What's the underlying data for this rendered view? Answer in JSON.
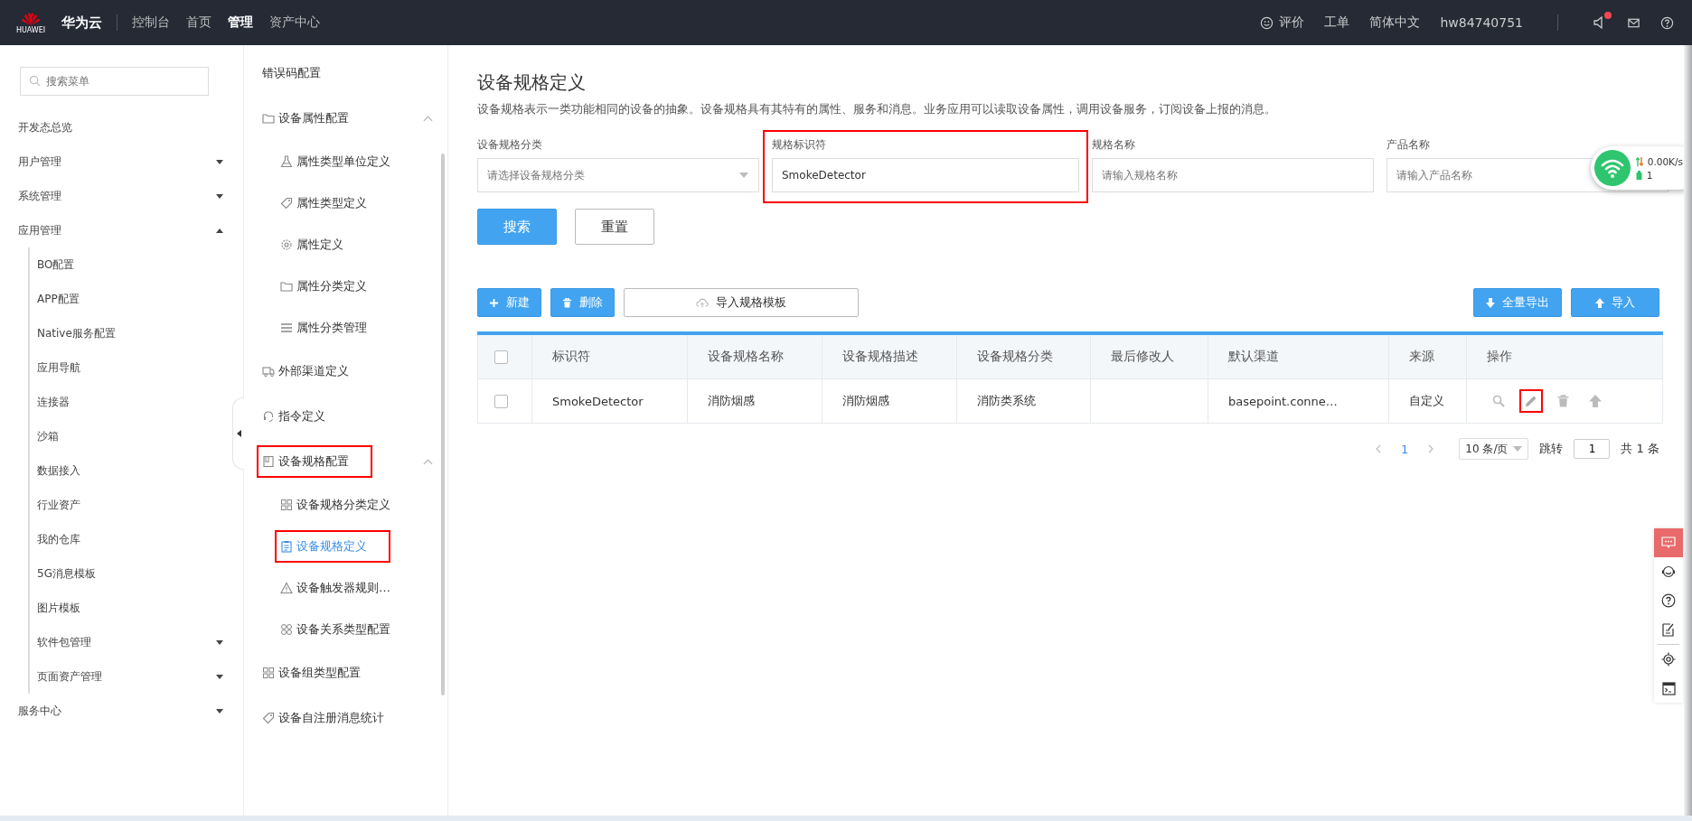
{
  "topbar": {
    "logo_text": "HUAWEI",
    "brand": "华为云",
    "nav": [
      {
        "label": "控制台",
        "selected": false
      },
      {
        "label": "首页",
        "selected": false
      },
      {
        "label": "管理",
        "selected": true
      },
      {
        "label": "资产中心",
        "selected": false
      }
    ],
    "right": {
      "feedback": "评价",
      "ticket": "工单",
      "language": "简体中文",
      "user": "hw84740751",
      "notification_dot": true
    }
  },
  "menu": {
    "search": {
      "placeholder": "搜索菜单"
    },
    "items": [
      {
        "label": "开发态总览"
      },
      {
        "label": "用户管理",
        "expanded": false
      },
      {
        "label": "系统管理",
        "expanded": false
      },
      {
        "label": "应用管理",
        "expanded": true,
        "children": [
          {
            "label": "BO配置"
          },
          {
            "label": "APP配置"
          },
          {
            "label": "Native服务配置"
          },
          {
            "label": "应用导航"
          },
          {
            "label": "连接器"
          },
          {
            "label": "沙箱"
          },
          {
            "label": "数据接入"
          },
          {
            "label": "行业资产"
          },
          {
            "label": "我的仓库"
          },
          {
            "label": "5G消息模板"
          },
          {
            "label": "图片模板"
          },
          {
            "label": "软件包管理",
            "expanded": false
          },
          {
            "label": "页面资产管理",
            "expanded": false
          }
        ]
      },
      {
        "label": "服务中心",
        "expanded": false
      }
    ]
  },
  "submenu": {
    "items": [
      {
        "label": "错误码配置",
        "highlighted": false,
        "selected": false
      },
      {
        "label": "设备属性配置",
        "expanded": true,
        "highlighted": false,
        "selected": false,
        "children": [
          {
            "label": "属性类型单位定义",
            "highlighted": false,
            "selected": false
          },
          {
            "label": "属性类型定义",
            "highlighted": false,
            "selected": false
          },
          {
            "label": "属性定义",
            "highlighted": false,
            "selected": false
          },
          {
            "label": "属性分类定义",
            "highlighted": false,
            "selected": false
          },
          {
            "label": "属性分类管理",
            "highlighted": false,
            "selected": false
          }
        ]
      },
      {
        "label": "外部渠道定义",
        "highlighted": false,
        "selected": false
      },
      {
        "label": "指令定义",
        "highlighted": false,
        "selected": false
      },
      {
        "label": "设备规格配置",
        "expanded": true,
        "highlighted": true,
        "selected": false,
        "children": [
          {
            "label": "设备规格分类定义",
            "highlighted": false,
            "selected": false
          },
          {
            "label": "设备规格定义",
            "highlighted": true,
            "selected": true
          },
          {
            "label": "设备触发器规则…",
            "highlighted": false,
            "selected": false
          },
          {
            "label": "设备关系类型配置",
            "highlighted": false,
            "selected": false
          }
        ]
      },
      {
        "label": "设备组类型配置",
        "highlighted": false,
        "selected": false
      },
      {
        "label": "设备自注册消息统计",
        "highlighted": false,
        "selected": false
      }
    ]
  },
  "page": {
    "title": "设备规格定义",
    "description": "设备规格表示一类功能相同的设备的抽象。设备规格具有其特有的属性、服务和消息。业务应用可以读取设备属性，调用设备服务，订阅设备上报的消息。",
    "filters": [
      {
        "label": "设备规格分类",
        "kind": "select",
        "placeholder": "请选择设备规格分类",
        "highlighted": false
      },
      {
        "label": "规格标识符",
        "kind": "text",
        "value": "SmokeDetector",
        "highlighted": true
      },
      {
        "label": "规格名称",
        "kind": "text",
        "placeholder": "请输入规格名称",
        "highlighted": false
      },
      {
        "label": "产品名称",
        "kind": "text",
        "placeholder": "请输入产品名称",
        "highlighted": false
      }
    ],
    "search_button": "搜索",
    "reset_button": "重置",
    "toolbar_left": [
      {
        "label": "新建",
        "kind": "primary"
      },
      {
        "label": "删除",
        "kind": "primary"
      },
      {
        "label": "导入规格模板",
        "kind": "outline"
      }
    ],
    "toolbar_right": [
      {
        "label": "全量导出",
        "kind": "primary"
      },
      {
        "label": "导入",
        "kind": "primary"
      }
    ],
    "table": {
      "all_checked": false,
      "columns": [
        "标识符",
        "设备规格名称",
        "设备规格描述",
        "设备规格分类",
        "最后修改人",
        "默认渠道",
        "来源",
        "操作"
      ],
      "rows": [
        {
          "checked": false,
          "cells": [
            "SmokeDetector",
            "消防烟感",
            "消防烟感",
            "消防类系统",
            "",
            "basepoint.conne…",
            "自定义"
          ],
          "actions": [
            {
              "kind": "view",
              "highlighted": false
            },
            {
              "kind": "edit",
              "highlighted": true
            },
            {
              "kind": "delete",
              "highlighted": false
            },
            {
              "kind": "upload",
              "highlighted": false
            }
          ]
        }
      ]
    },
    "pagination": {
      "current": "1",
      "page_size": "10 条/页",
      "jump_label": "跳转",
      "jump_value": "1",
      "total": "共 1 条"
    }
  },
  "network_widget": {
    "speed": "0.00K/s",
    "count": "1"
  }
}
